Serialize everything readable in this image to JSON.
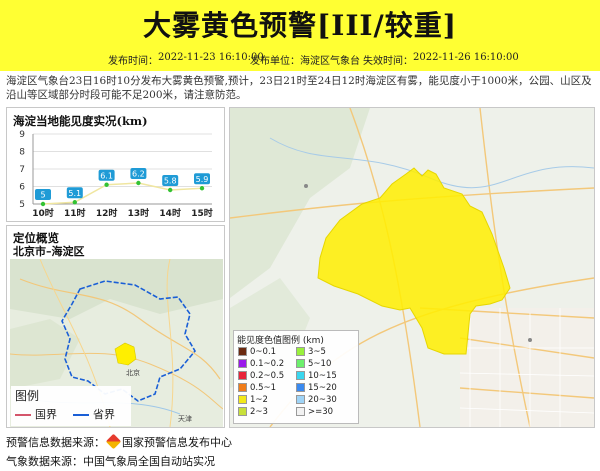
{
  "header": {
    "title": "大雾黄色预警[III/较重]",
    "publish_label": "发布时间：",
    "publish_time": "2022-11-23 16:10:00",
    "unit_label": "发布单位：",
    "unit": "海淀区气象台",
    "expire_label": "失效时间：",
    "expire_time": "2022-11-26 16:10:00"
  },
  "description": "海淀区气象台23日16时10分发布大雾黄色预警,预计，23日21时至24日12时海淀区有雾，能见度小于1000米，公园、山区及沿山等区域部分时段可能不足200米，请注意防范。",
  "visibility_panel": {
    "title": "海淀当地能见度实况(km)"
  },
  "chart_data": {
    "type": "line",
    "title": "海淀当地能见度实况(km)",
    "categories": [
      "10时",
      "11时",
      "12时",
      "13时",
      "14时",
      "15时"
    ],
    "values": [
      5,
      5.1,
      6.1,
      6.2,
      5.8,
      5.9
    ],
    "value_labels": [
      "5",
      "5.1",
      "6.1",
      "6.2",
      "5.8",
      "5.9"
    ],
    "yticks": [
      "5",
      "6",
      "7",
      "8",
      "9"
    ],
    "ylim": [
      5,
      9
    ],
    "grid": true,
    "line_color": "#f0e6a0",
    "marker_color": "#33c233",
    "label_color": "#1f9bd6"
  },
  "location_panel": {
    "title": "定位概览",
    "region": "北京市–海淀区",
    "legend_title": "图例",
    "legend_items": [
      {
        "label": "国界",
        "color": "#d4556b"
      },
      {
        "label": "省界",
        "color": "#1a5fd6"
      }
    ],
    "place_labels": [
      "北京",
      "天津"
    ]
  },
  "visibility_legend": {
    "title": "能见度色值图例 (km)",
    "items": [
      {
        "label": "0~0.1",
        "color": "#6b2a10"
      },
      {
        "label": "3~5",
        "color": "#99f03c"
      },
      {
        "label": "0.1~0.2",
        "color": "#9a1aeb"
      },
      {
        "label": "5~10",
        "color": "#6cef6c"
      },
      {
        "label": "0.2~0.5",
        "color": "#e8243a"
      },
      {
        "label": "10~15",
        "color": "#3ad6ef"
      },
      {
        "label": "0.5~1",
        "color": "#f07d1a"
      },
      {
        "label": "15~20",
        "color": "#3b8af0"
      },
      {
        "label": "1~2",
        "color": "#f3e91a"
      },
      {
        "label": "20~30",
        "color": "#9fd4f7"
      },
      {
        "label": "2~3",
        "color": "#c8e03a"
      },
      {
        "label": ">=30",
        "color": "#f2f2f2"
      }
    ]
  },
  "footer": {
    "source_label": "预警信息数据来源：",
    "source": "国家预警信息发布中心",
    "weather_label": "气象数据来源：",
    "weather_source": "中国气象局全国自动站实况"
  },
  "colors": {
    "banner": "#ffff33",
    "warning_area": "#ffef00"
  }
}
